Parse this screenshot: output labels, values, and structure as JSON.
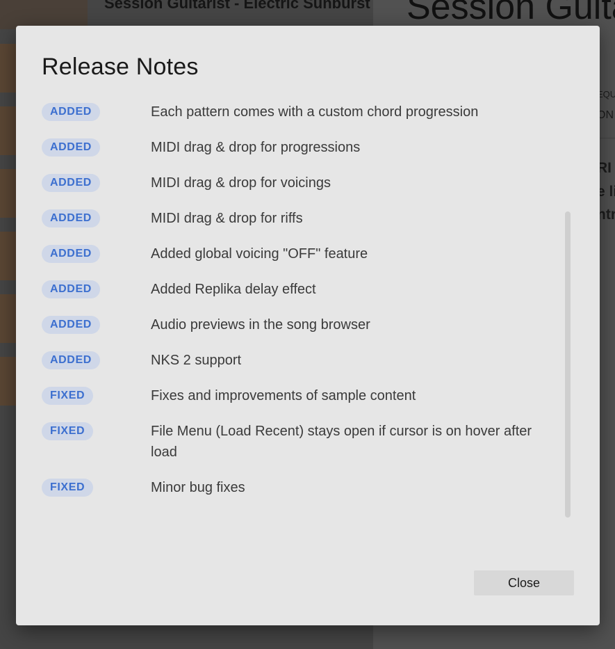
{
  "background": {
    "product_title": "Session Guitarist - Electric Sunburst",
    "big_title": "Session Guita",
    "fragments": [
      "EQU",
      "ON",
      "RI",
      "e li",
      "ntro"
    ]
  },
  "modal": {
    "title": "Release Notes",
    "notes": [
      {
        "tag": "ADDED",
        "text": "Each pattern comes with a custom chord progression"
      },
      {
        "tag": "ADDED",
        "text": "MIDI drag & drop for progressions"
      },
      {
        "tag": "ADDED",
        "text": "MIDI drag & drop for voicings"
      },
      {
        "tag": "ADDED",
        "text": "MIDI drag & drop for riffs"
      },
      {
        "tag": "ADDED",
        "text": "Added global voicing \"OFF\" feature"
      },
      {
        "tag": "ADDED",
        "text": "Added Replika delay effect"
      },
      {
        "tag": "ADDED",
        "text": "Audio previews in the song browser"
      },
      {
        "tag": "ADDED",
        "text": "NKS 2 support"
      },
      {
        "tag": "FIXED",
        "text": "Fixes and improvements of sample content"
      },
      {
        "tag": "FIXED",
        "text": "File Menu (Load Recent) stays open if cursor is on hover after load"
      },
      {
        "tag": "FIXED",
        "text": "Minor bug fixes"
      }
    ],
    "close_label": "Close"
  },
  "colors": {
    "badge_bg": "#cfd7e8",
    "badge_text": "#3c6fcf",
    "modal_bg": "#e6e6e6"
  }
}
